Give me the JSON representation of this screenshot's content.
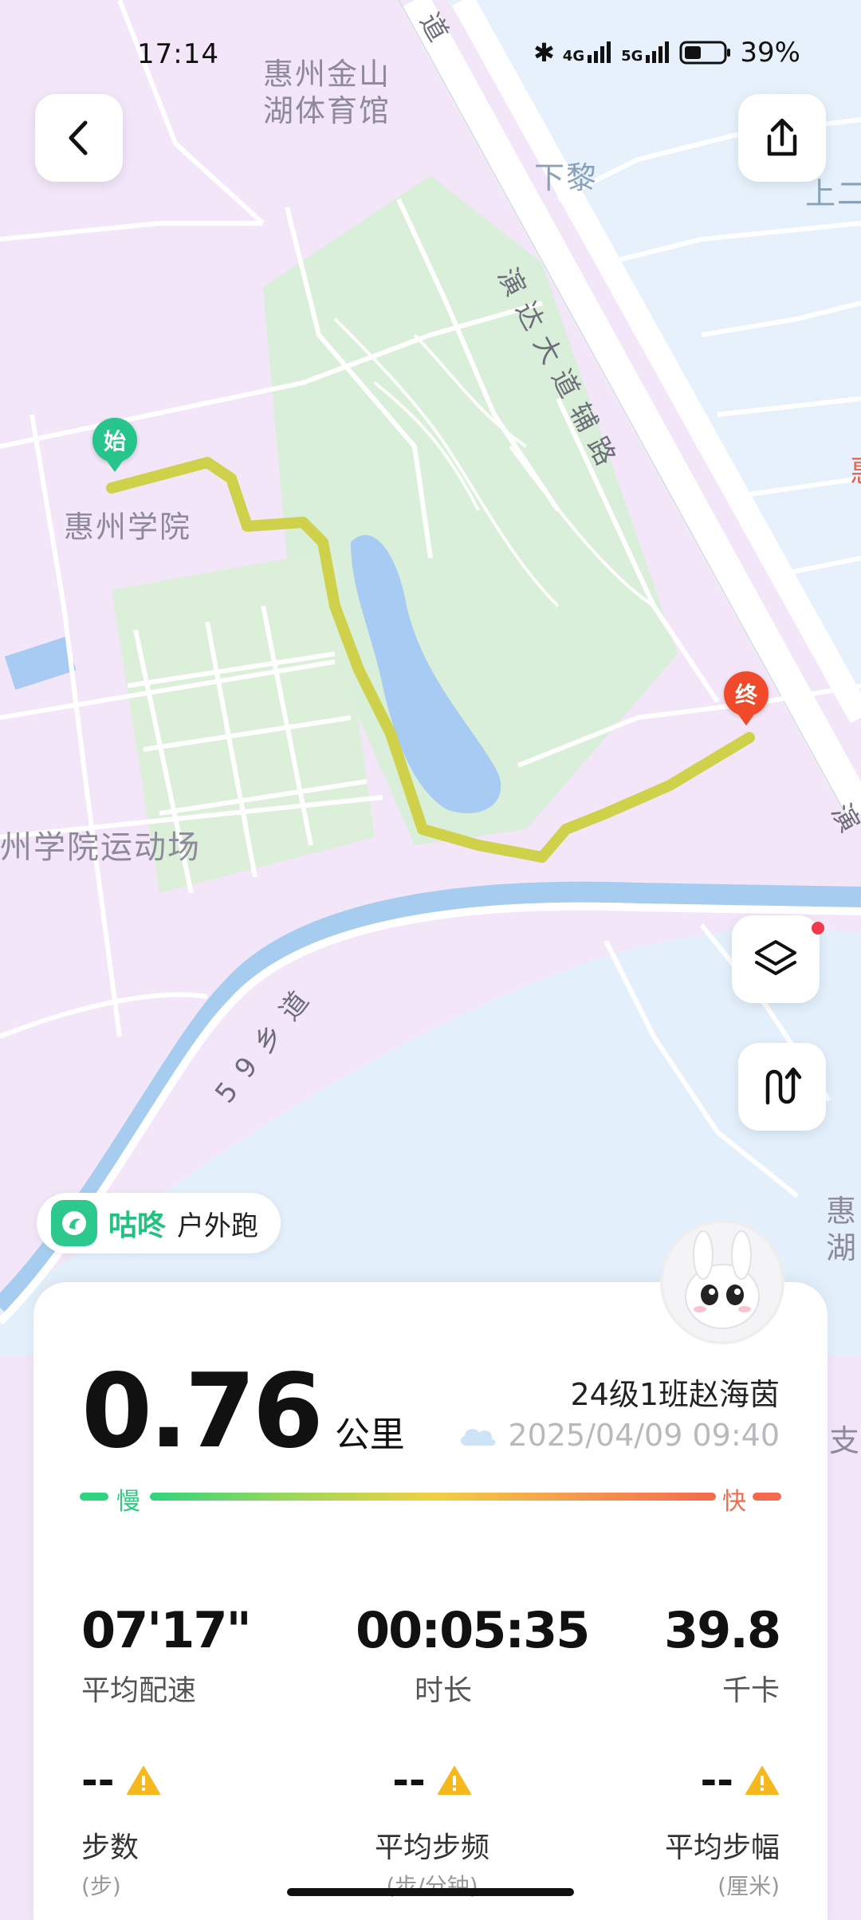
{
  "status_bar": {
    "time": "17:14",
    "network": "4G",
    "network2": "5G",
    "battery": "39%"
  },
  "map": {
    "labels": {
      "gym": "惠州金山\n湖体育馆",
      "college": "惠州学院",
      "sports_field": "州学院运动场",
      "xiali": "下黎",
      "shang": "上二",
      "avenue_side_road": "演达大道辅路",
      "avenue": "道",
      "road_59": "59乡道",
      "right_edge_1": "惠",
      "right_edge_2": "惠\n湖",
      "right_edge_3": "支纟",
      "right_edge_4": "演"
    },
    "start_marker": "始",
    "end_marker": "终",
    "route_color": "#cfd14a"
  },
  "brand": {
    "name": "咕咚",
    "mode": "户外跑"
  },
  "summary": {
    "distance": "0.76",
    "distance_unit": "公里",
    "user": "24级1班赵海茵",
    "datetime": "2025/04/09 09:40",
    "pace_slow": "慢",
    "pace_fast": "快"
  },
  "stats": [
    {
      "value": "07'17\"",
      "label": "平均配速"
    },
    {
      "value": "00:05:35",
      "label": "时长"
    },
    {
      "value": "39.8",
      "label": "千卡"
    }
  ],
  "stats2": [
    {
      "value": "--",
      "label": "步数",
      "unit": "(步)"
    },
    {
      "value": "--",
      "label": "平均步频",
      "unit": "(步/分钟)"
    },
    {
      "value": "--",
      "label": "平均步幅",
      "unit": "(厘米)"
    }
  ],
  "colors": {
    "accent": "#22c17f",
    "end_red": "#f04a2a"
  }
}
